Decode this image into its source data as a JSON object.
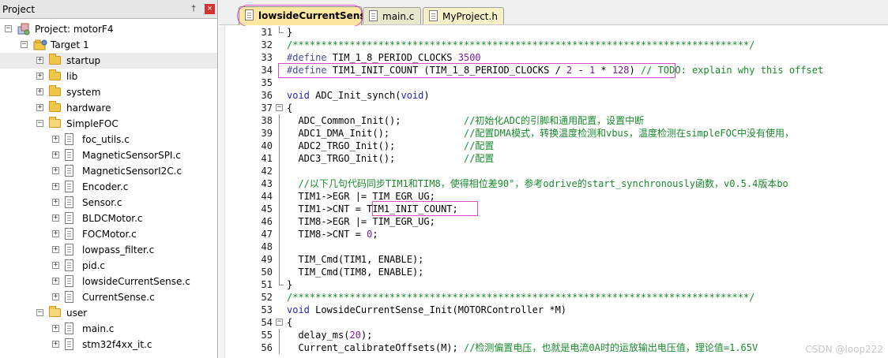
{
  "project_pane": {
    "title": "Project",
    "pin_glyph": "†",
    "close_glyph": "×",
    "tree": [
      {
        "label": "Project: motorF4",
        "level": 0,
        "kind": "project",
        "expander": "−"
      },
      {
        "label": "Target 1",
        "level": 1,
        "kind": "target",
        "expander": "−"
      },
      {
        "label": "startup",
        "level": 2,
        "kind": "folder",
        "expander": "+",
        "selected": true
      },
      {
        "label": "lib",
        "level": 2,
        "kind": "folder",
        "expander": "+"
      },
      {
        "label": "system",
        "level": 2,
        "kind": "folder",
        "expander": "+"
      },
      {
        "label": "hardware",
        "level": 2,
        "kind": "folder",
        "expander": "+"
      },
      {
        "label": "SimpleFOC",
        "level": 2,
        "kind": "folder-open",
        "expander": "−"
      },
      {
        "label": "foc_utils.c",
        "level": 3,
        "kind": "file",
        "expander": "+"
      },
      {
        "label": "MagneticSensorSPI.c",
        "level": 3,
        "kind": "file",
        "expander": "+"
      },
      {
        "label": "MagneticSensorI2C.c",
        "level": 3,
        "kind": "file",
        "expander": "+"
      },
      {
        "label": "Encoder.c",
        "level": 3,
        "kind": "file",
        "expander": "+"
      },
      {
        "label": "Sensor.c",
        "level": 3,
        "kind": "file",
        "expander": "+"
      },
      {
        "label": "BLDCMotor.c",
        "level": 3,
        "kind": "file",
        "expander": "+"
      },
      {
        "label": "FOCMotor.c",
        "level": 3,
        "kind": "file",
        "expander": "+"
      },
      {
        "label": "lowpass_filter.c",
        "level": 3,
        "kind": "file",
        "expander": "+"
      },
      {
        "label": "pid.c",
        "level": 3,
        "kind": "file",
        "expander": "+"
      },
      {
        "label": "lowsideCurrentSense.c",
        "level": 3,
        "kind": "file",
        "expander": "+"
      },
      {
        "label": "CurrentSense.c",
        "level": 3,
        "kind": "file",
        "expander": "+"
      },
      {
        "label": "user",
        "level": 2,
        "kind": "folder-open",
        "expander": "−"
      },
      {
        "label": "main.c",
        "level": 3,
        "kind": "file",
        "expander": "+"
      },
      {
        "label": "stm32f4xx_it.c",
        "level": 3,
        "kind": "file",
        "expander": "+"
      }
    ]
  },
  "tabs": [
    {
      "label": "lowsideCurrentSense.c",
      "active": true
    },
    {
      "label": "main.c",
      "active": false
    },
    {
      "label": "MyProject.h",
      "active": false
    }
  ],
  "editor": {
    "lines": [
      {
        "n": "31",
        "fold": "end",
        "tokens": [
          {
            "t": "}",
            "c": ""
          }
        ]
      },
      {
        "n": "32",
        "fold": "",
        "tokens": [
          {
            "t": "/********************************************************************************/",
            "c": "c-green"
          }
        ]
      },
      {
        "n": "33",
        "fold": "",
        "tokens": [
          {
            "t": "#define",
            "c": "c-pp"
          },
          {
            "t": " TIM_1_8_PERIOD_CLOCKS ",
            "c": ""
          },
          {
            "t": "3500",
            "c": "c-num"
          }
        ]
      },
      {
        "n": "34",
        "fold": "",
        "tokens": [
          {
            "t": "#define",
            "c": "c-pp"
          },
          {
            "t": " TIM1_INIT_COUNT (TIM_1_8_PERIOD_CLOCKS / ",
            "c": ""
          },
          {
            "t": "2",
            "c": "c-num"
          },
          {
            "t": " - ",
            "c": ""
          },
          {
            "t": "1",
            "c": "c-num"
          },
          {
            "t": " * ",
            "c": ""
          },
          {
            "t": "128",
            "c": "c-num"
          },
          {
            "t": ") ",
            "c": ""
          },
          {
            "t": "// TODO: explain why this offset",
            "c": "c-green"
          }
        ]
      },
      {
        "n": "35",
        "fold": "",
        "tokens": []
      },
      {
        "n": "36",
        "fold": "",
        "tokens": [
          {
            "t": "void",
            "c": "c-kw"
          },
          {
            "t": " ADC_Init_synch(",
            "c": ""
          },
          {
            "t": "void",
            "c": "c-kw"
          },
          {
            "t": ")",
            "c": ""
          }
        ]
      },
      {
        "n": "37",
        "fold": "open",
        "tokens": [
          {
            "t": "{",
            "c": ""
          }
        ]
      },
      {
        "n": "38",
        "fold": "vert",
        "tokens": [
          {
            "t": "  ADC_Common_Init();           ",
            "c": ""
          },
          {
            "t": "//初始化ADC的引脚和通用配置，设置中断",
            "c": "c-green"
          }
        ]
      },
      {
        "n": "39",
        "fold": "vert",
        "tokens": [
          {
            "t": "  ADC1_DMA_Init();             ",
            "c": ""
          },
          {
            "t": "//配置DMA模式，转换温度检测和vbus，温度检测在simpleFOC中没有使用，",
            "c": "c-green"
          }
        ]
      },
      {
        "n": "40",
        "fold": "vert",
        "tokens": [
          {
            "t": "  ADC2_TRGO_Init();            ",
            "c": ""
          },
          {
            "t": "//配置",
            "c": "c-green"
          }
        ]
      },
      {
        "n": "41",
        "fold": "vert",
        "tokens": [
          {
            "t": "  ADC3_TRGO_Init();            ",
            "c": ""
          },
          {
            "t": "//配置",
            "c": "c-green"
          }
        ]
      },
      {
        "n": "42",
        "fold": "vert",
        "tokens": []
      },
      {
        "n": "43",
        "fold": "vert",
        "tokens": [
          {
            "t": "  //以下几句代码同步TIM1和TIM8，使得相位差90°，参考odrive的start_synchronously函数，v0.5.4版本bo",
            "c": "c-green"
          }
        ]
      },
      {
        "n": "44",
        "fold": "vert",
        "tokens": [
          {
            "t": "  TIM1->EGR |= TIM_EGR_UG;",
            "c": ""
          }
        ]
      },
      {
        "n": "45",
        "fold": "vert",
        "tokens": [
          {
            "t": "  TIM1->CNT = TIM1_INIT_COUNT;",
            "c": ""
          }
        ]
      },
      {
        "n": "46",
        "fold": "vert",
        "tokens": [
          {
            "t": "  TIM8->EGR |= TIM_EGR_UG;",
            "c": ""
          }
        ]
      },
      {
        "n": "47",
        "fold": "vert",
        "tokens": [
          {
            "t": "  TIM8->CNT = ",
            "c": ""
          },
          {
            "t": "0",
            "c": "c-num"
          },
          {
            "t": ";",
            "c": ""
          }
        ]
      },
      {
        "n": "48",
        "fold": "vert",
        "tokens": []
      },
      {
        "n": "49",
        "fold": "vert",
        "tokens": [
          {
            "t": "  TIM_Cmd(TIM1, ENABLE);",
            "c": ""
          }
        ]
      },
      {
        "n": "50",
        "fold": "vert",
        "tokens": [
          {
            "t": "  TIM_Cmd(TIM8, ENABLE);",
            "c": ""
          }
        ]
      },
      {
        "n": "51",
        "fold": "end",
        "tokens": [
          {
            "t": "}",
            "c": ""
          }
        ]
      },
      {
        "n": "52",
        "fold": "",
        "tokens": [
          {
            "t": "/********************************************************************************/",
            "c": "c-green"
          }
        ]
      },
      {
        "n": "53",
        "fold": "",
        "tokens": [
          {
            "t": "void",
            "c": "c-kw"
          },
          {
            "t": " LowsideCurrentSense_Init(MOTORController *M)",
            "c": ""
          }
        ]
      },
      {
        "n": "54",
        "fold": "open",
        "tokens": [
          {
            "t": "{",
            "c": ""
          }
        ]
      },
      {
        "n": "55",
        "fold": "vert",
        "tokens": [
          {
            "t": "  delay_ms(",
            "c": ""
          },
          {
            "t": "20",
            "c": "c-num"
          },
          {
            "t": ");",
            "c": ""
          }
        ]
      },
      {
        "n": "56",
        "fold": "vert",
        "tokens": [
          {
            "t": "  Current_calibrateOffsets(M); ",
            "c": ""
          },
          {
            "t": "//检测偏置电压，也就是电流0A时的运放输出电压值，理论值=1.65V",
            "c": "c-green"
          }
        ]
      }
    ]
  },
  "watermark": "CSDN @loop222",
  "colors": {
    "highlight_box": "#d44fc6",
    "active_tab": "#fbe7a0",
    "comment": "#178a2b",
    "keyword": "#1f1fc3"
  }
}
